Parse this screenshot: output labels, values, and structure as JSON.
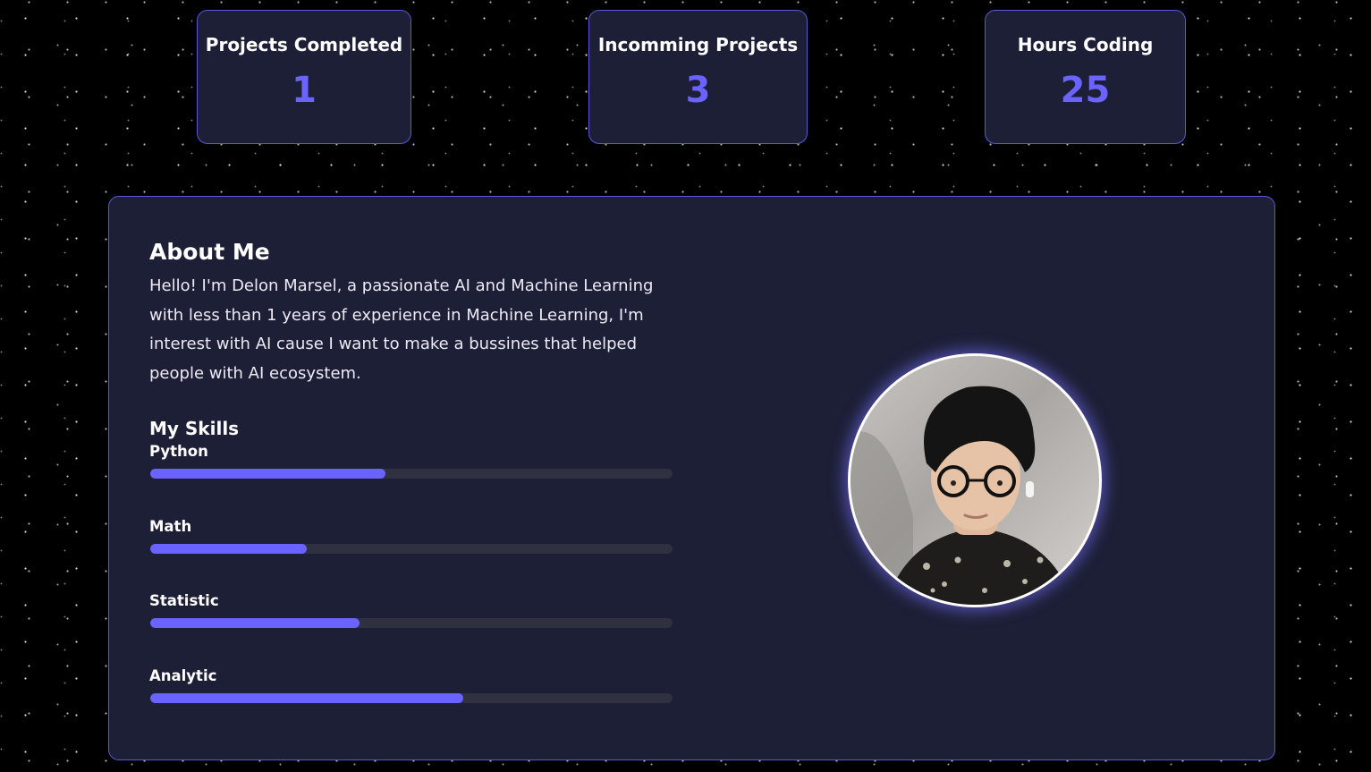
{
  "stats": [
    {
      "label": "Projects Completed",
      "value": "1"
    },
    {
      "label": "Incomming Projects",
      "value": "3"
    },
    {
      "label": "Hours Coding",
      "value": "25"
    }
  ],
  "about": {
    "title": "About Me",
    "text": "Hello! I'm Delon Marsel, a passionate AI and Machine Learning with less than 1 years of experience in Machine Learning, I'm interest with AI cause I want to make a bussines that helped people with AI ecosystem."
  },
  "skills": {
    "title": "My Skills",
    "items": [
      {
        "name": "Python",
        "level": 45
      },
      {
        "name": "Math",
        "level": 30
      },
      {
        "name": "Statistic",
        "level": 40
      },
      {
        "name": "Analytic",
        "level": 60
      }
    ]
  },
  "colors": {
    "accent": "#6a63ff",
    "card_bg": "#1d1f36",
    "border": "#5b57d6",
    "track": "#2f3140"
  }
}
